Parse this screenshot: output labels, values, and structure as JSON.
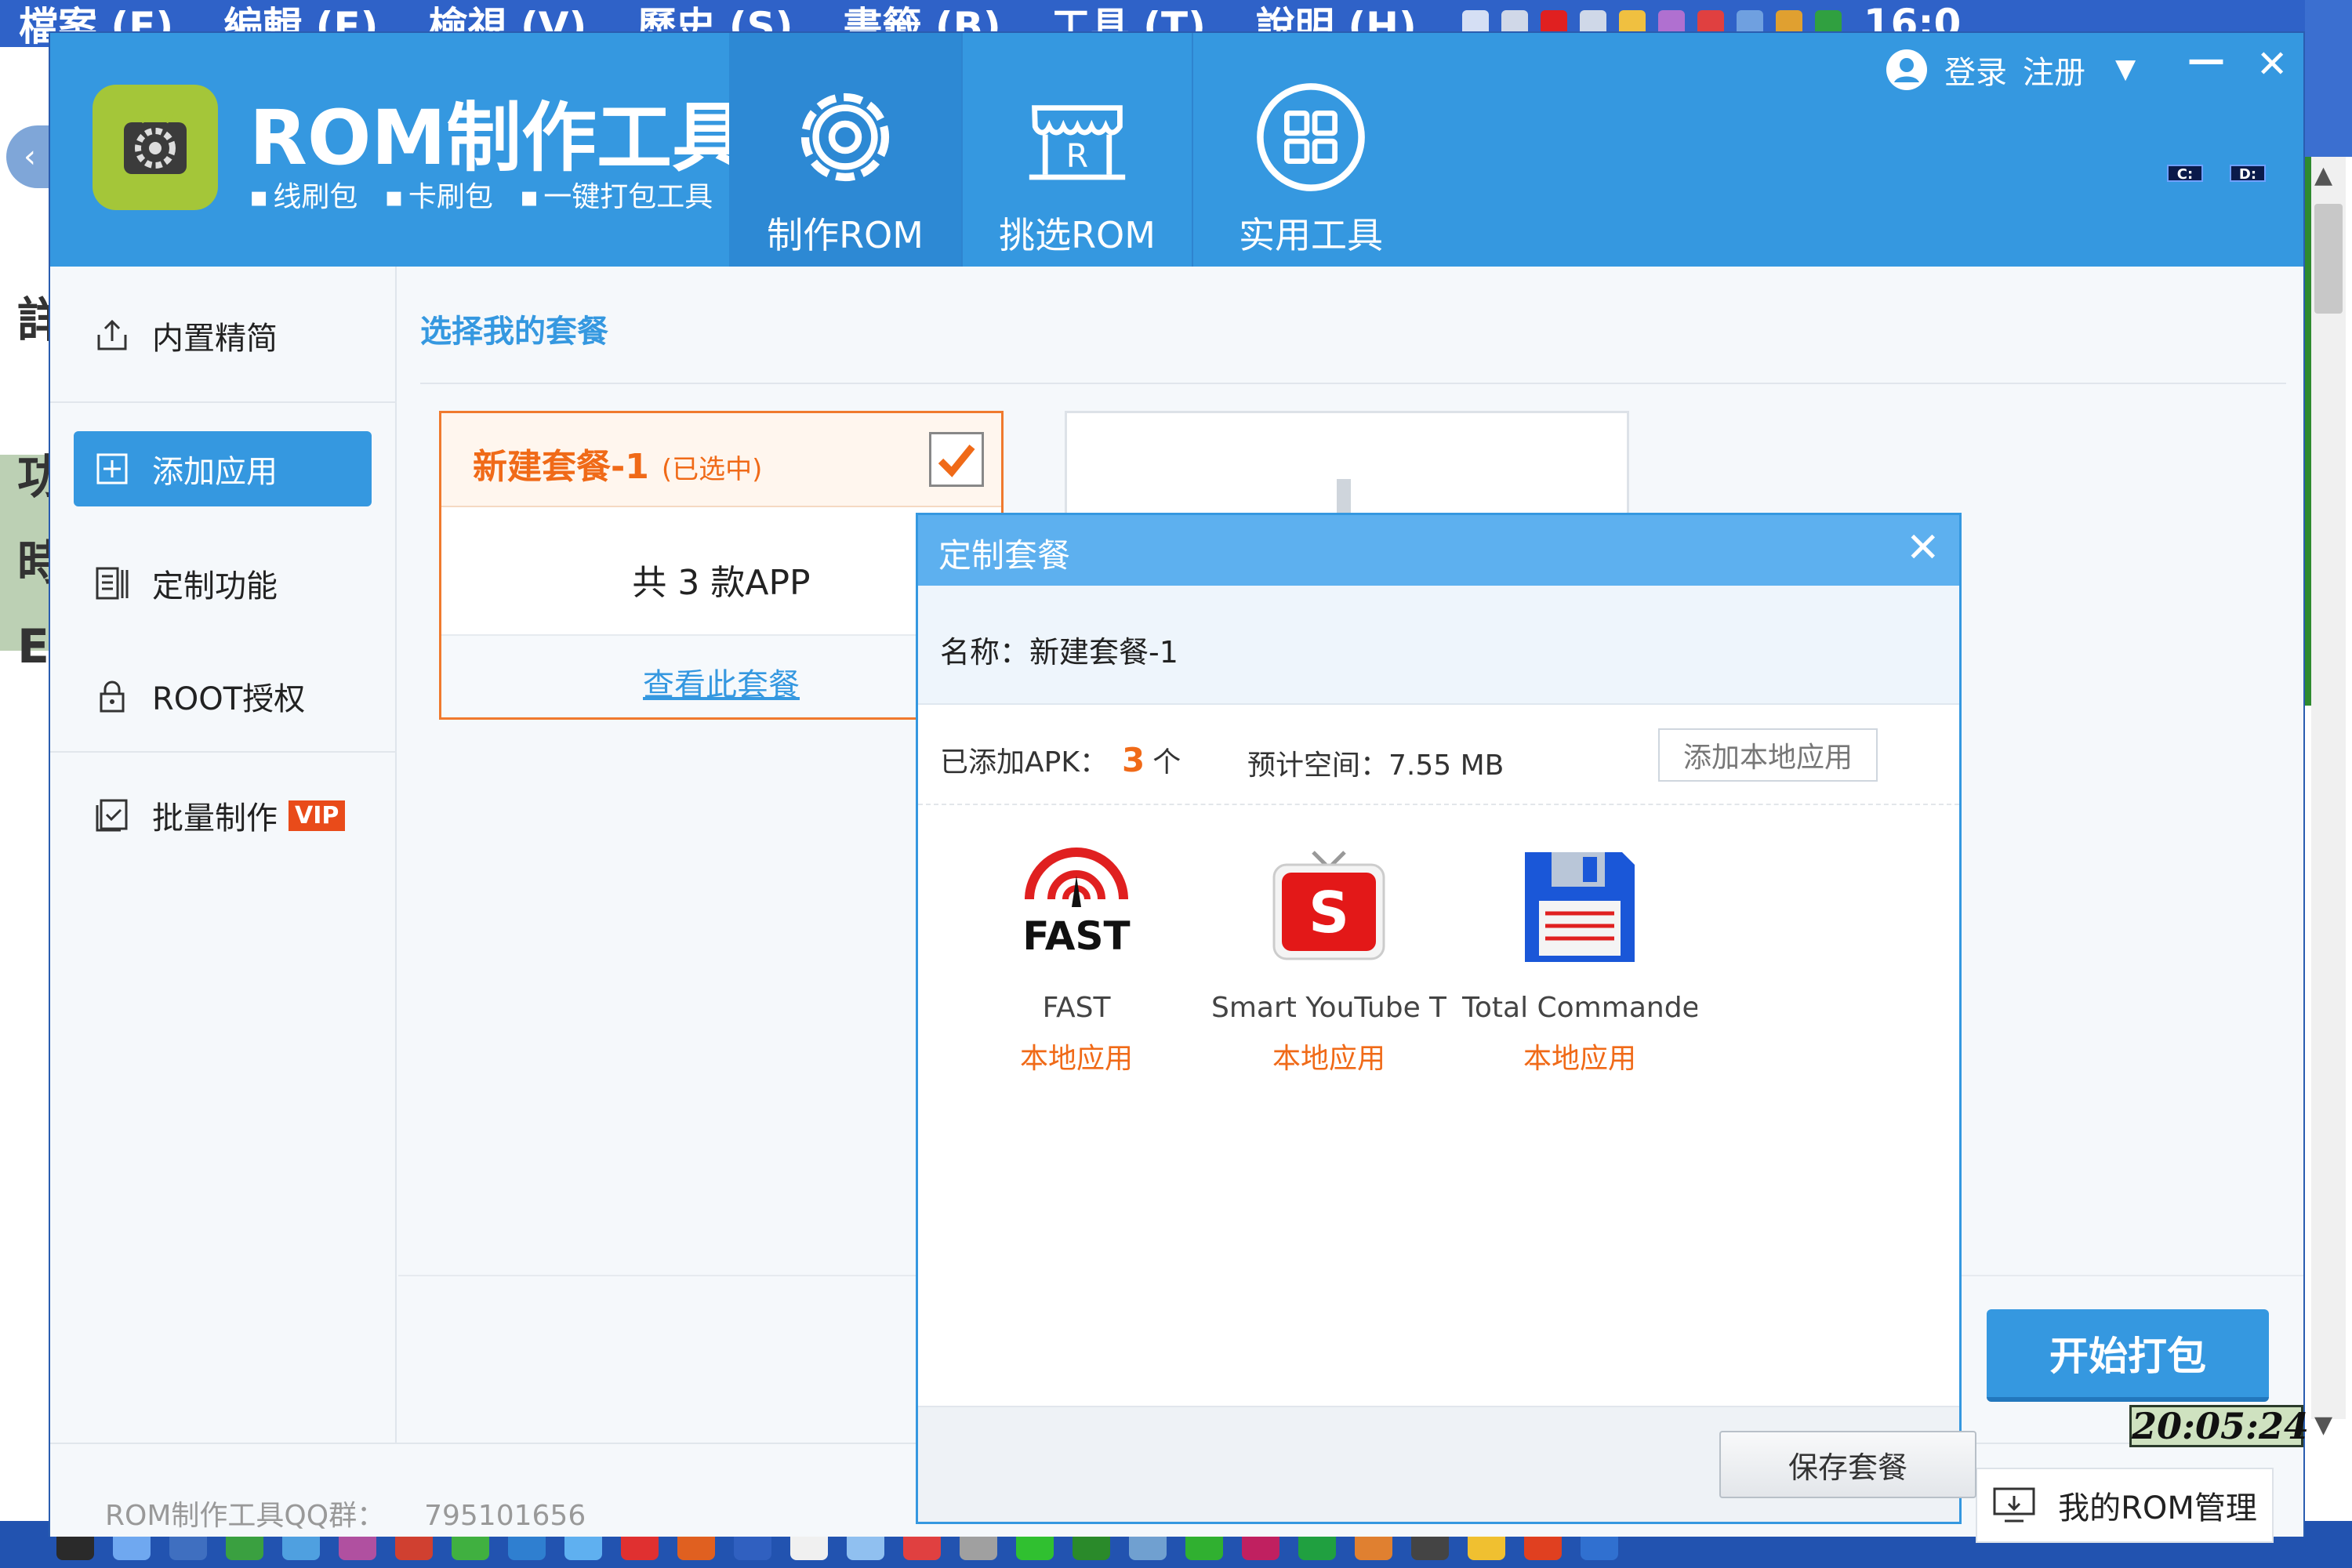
{
  "background": {
    "menubar": {
      "menus": [
        "檔案 (F)",
        "編輯 (E)",
        "檢視 (V)",
        "歷史 (S)",
        "書籤 (B)",
        "工具 (T)",
        "說明 (H)"
      ],
      "clock": "16:0"
    },
    "left_chars": [
      "詳",
      "功",
      "時",
      "E"
    ],
    "clock_box": "20:05:24"
  },
  "window": {
    "app_title": "ROM制作工具",
    "subtitle": [
      "线刷包",
      "卡刷包",
      "一键打包工具"
    ],
    "nav": [
      {
        "label": "制作ROM",
        "icon": "gear-icon",
        "active": true
      },
      {
        "label": "挑选ROM",
        "icon": "rom-store-icon",
        "active": false
      },
      {
        "label": "实用工具",
        "icon": "grid-icon",
        "active": false
      }
    ],
    "user": {
      "login": "登录",
      "register": "注册"
    },
    "drives": [
      "C:",
      "D:"
    ]
  },
  "sidebar": {
    "items": [
      {
        "label": "内置精简",
        "icon": "export-icon",
        "active": false
      },
      {
        "label": "添加应用",
        "icon": "plus-box-icon",
        "active": true
      },
      {
        "label": "定制功能",
        "icon": "custom-icon",
        "active": false
      },
      {
        "label": "ROOT授权",
        "icon": "lock-icon",
        "active": false
      },
      {
        "label": "批量制作",
        "icon": "checklist-icon",
        "active": false,
        "badge": "VIP"
      }
    ]
  },
  "content": {
    "section_title": "选择我的套餐",
    "package": {
      "name": "新建套餐-1",
      "status": "(已选中)",
      "count_text": "共 3 款APP",
      "view_link": "查看此套餐",
      "checked": true
    },
    "start_button": "开始打包",
    "footer": {
      "qq_label": "ROM制作工具QQ群：",
      "qq_number": "795101656",
      "my_rom_button": "我的ROM管理"
    }
  },
  "modal": {
    "title": "定制套餐",
    "name_line": "名称：新建套餐-1",
    "added_label": "已添加APK：",
    "added_count": "3",
    "added_unit": "个",
    "space_label": "预计空间：7.55 MB",
    "add_local_button": "添加本地应用",
    "apps": [
      {
        "name": "FAST",
        "source": "本地应用",
        "icon": "fast-speedtest-icon"
      },
      {
        "name": "Smart YouTube TV",
        "source": "本地应用",
        "icon": "smart-youtube-icon"
      },
      {
        "name": "Total Commander",
        "source": "本地应用",
        "icon": "floppy-disk-icon"
      }
    ],
    "save_button": "保存套餐"
  },
  "colors": {
    "primary_blue": "#3598e0",
    "accent_orange": "#f06a18",
    "android_green": "#a4c639"
  }
}
